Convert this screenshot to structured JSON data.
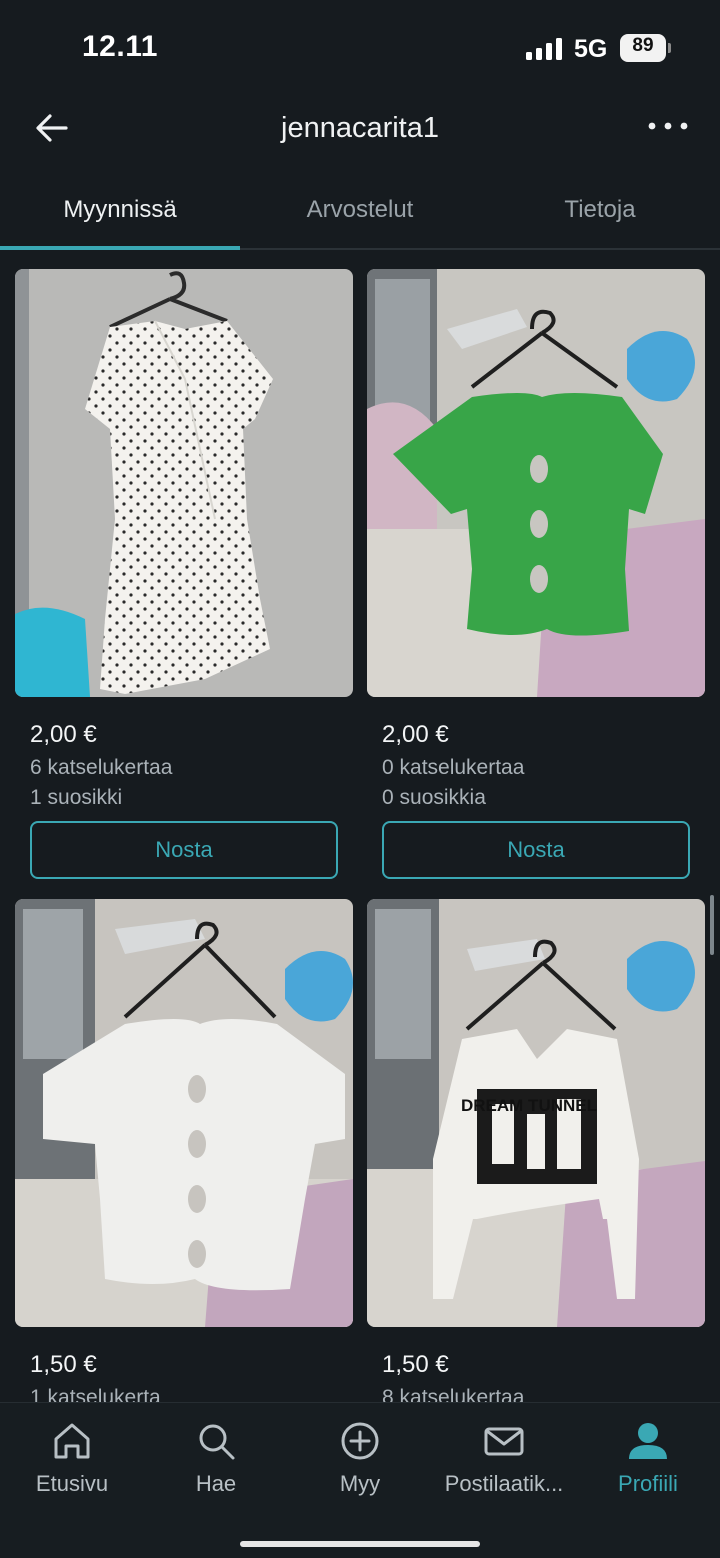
{
  "status_bar": {
    "time": "12.11",
    "network": "5G",
    "battery": "89"
  },
  "header": {
    "title": "jennacarita1",
    "back_icon": "arrow-left-icon",
    "more_icon": "more-horizontal-icon"
  },
  "tabs": [
    {
      "label": "Myynnissä",
      "active": true
    },
    {
      "label": "Arvostelut",
      "active": false
    },
    {
      "label": "Tietoja",
      "active": false
    }
  ],
  "listings": [
    {
      "price": "2,00 €",
      "views": "6 katselukertaa",
      "favorites": "1 suosikki",
      "button": "Nosta",
      "photo": "white polka-dot wrap dress on hanger"
    },
    {
      "price": "2,00 €",
      "views": "0 katselukertaa",
      "favorites": "0 suosikkia",
      "button": "Nosta",
      "photo": "green ribbed top with cut-outs on hanger"
    },
    {
      "price": "1,50 €",
      "views": "1 katselukerta",
      "favorites": "",
      "button": "",
      "photo": "white ribbed top with cut-outs on hanger"
    },
    {
      "price": "1,50 €",
      "views": "8 katselukertaa",
      "favorites": "",
      "button": "",
      "photo": "white long-sleeve crop top with print on hanger"
    }
  ],
  "colors": {
    "background": "#161b1f",
    "accent": "#3aa8b4",
    "muted_text": "#aab2b8"
  },
  "bottom_nav": [
    {
      "label": "Etusivu",
      "icon": "home-icon",
      "active": false
    },
    {
      "label": "Hae",
      "icon": "search-icon",
      "active": false
    },
    {
      "label": "Myy",
      "icon": "plus-circle-icon",
      "active": false
    },
    {
      "label": "Postilaatik...",
      "icon": "mail-icon",
      "active": false
    },
    {
      "label": "Profiili",
      "icon": "profile-icon",
      "active": true
    }
  ]
}
